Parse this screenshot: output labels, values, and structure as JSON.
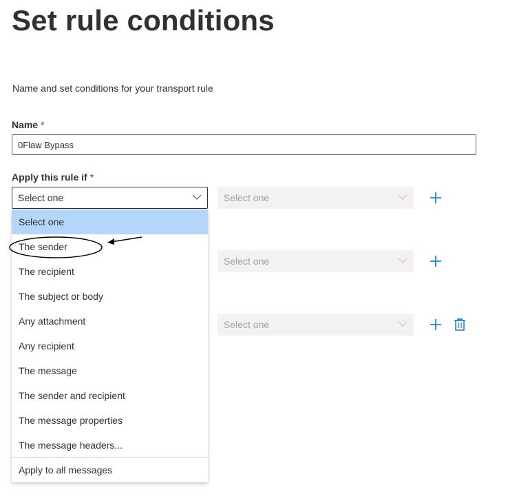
{
  "page": {
    "title": "Set rule conditions",
    "description": "Name and set conditions for your transport rule"
  },
  "name_field": {
    "label": "Name",
    "required_marker": "*",
    "value": "0Flaw Bypass"
  },
  "apply_rule": {
    "label": "Apply this rule if",
    "required_marker": "*",
    "selected_value": "Select one"
  },
  "secondary_selects": [
    {
      "value": "Select one"
    },
    {
      "value": "Select one"
    },
    {
      "value": "Select one"
    }
  ],
  "dropdown": {
    "options": [
      {
        "label": "Select one",
        "selected": true
      },
      {
        "label": "The sender",
        "selected": false,
        "annotated": true
      },
      {
        "label": "The recipient",
        "selected": false
      },
      {
        "label": "The subject or body",
        "selected": false
      },
      {
        "label": "Any attachment",
        "selected": false
      },
      {
        "label": "Any recipient",
        "selected": false
      },
      {
        "label": "The message",
        "selected": false
      },
      {
        "label": "The sender and recipient",
        "selected": false
      },
      {
        "label": "The message properties",
        "selected": false
      },
      {
        "label": "The message headers...",
        "selected": false
      }
    ],
    "footer_option": {
      "label": "Apply to all messages"
    }
  },
  "icons": {
    "add": "plus-icon",
    "delete": "trash-icon",
    "chevron": "chevron-down-icon"
  },
  "colors": {
    "accent": "#0078d4",
    "selected_option_bg": "#b4d6fa",
    "disabled_bg": "#f3f2f1",
    "disabled_text": "#a19f9d",
    "required": "#a4262c",
    "text": "#323130"
  }
}
